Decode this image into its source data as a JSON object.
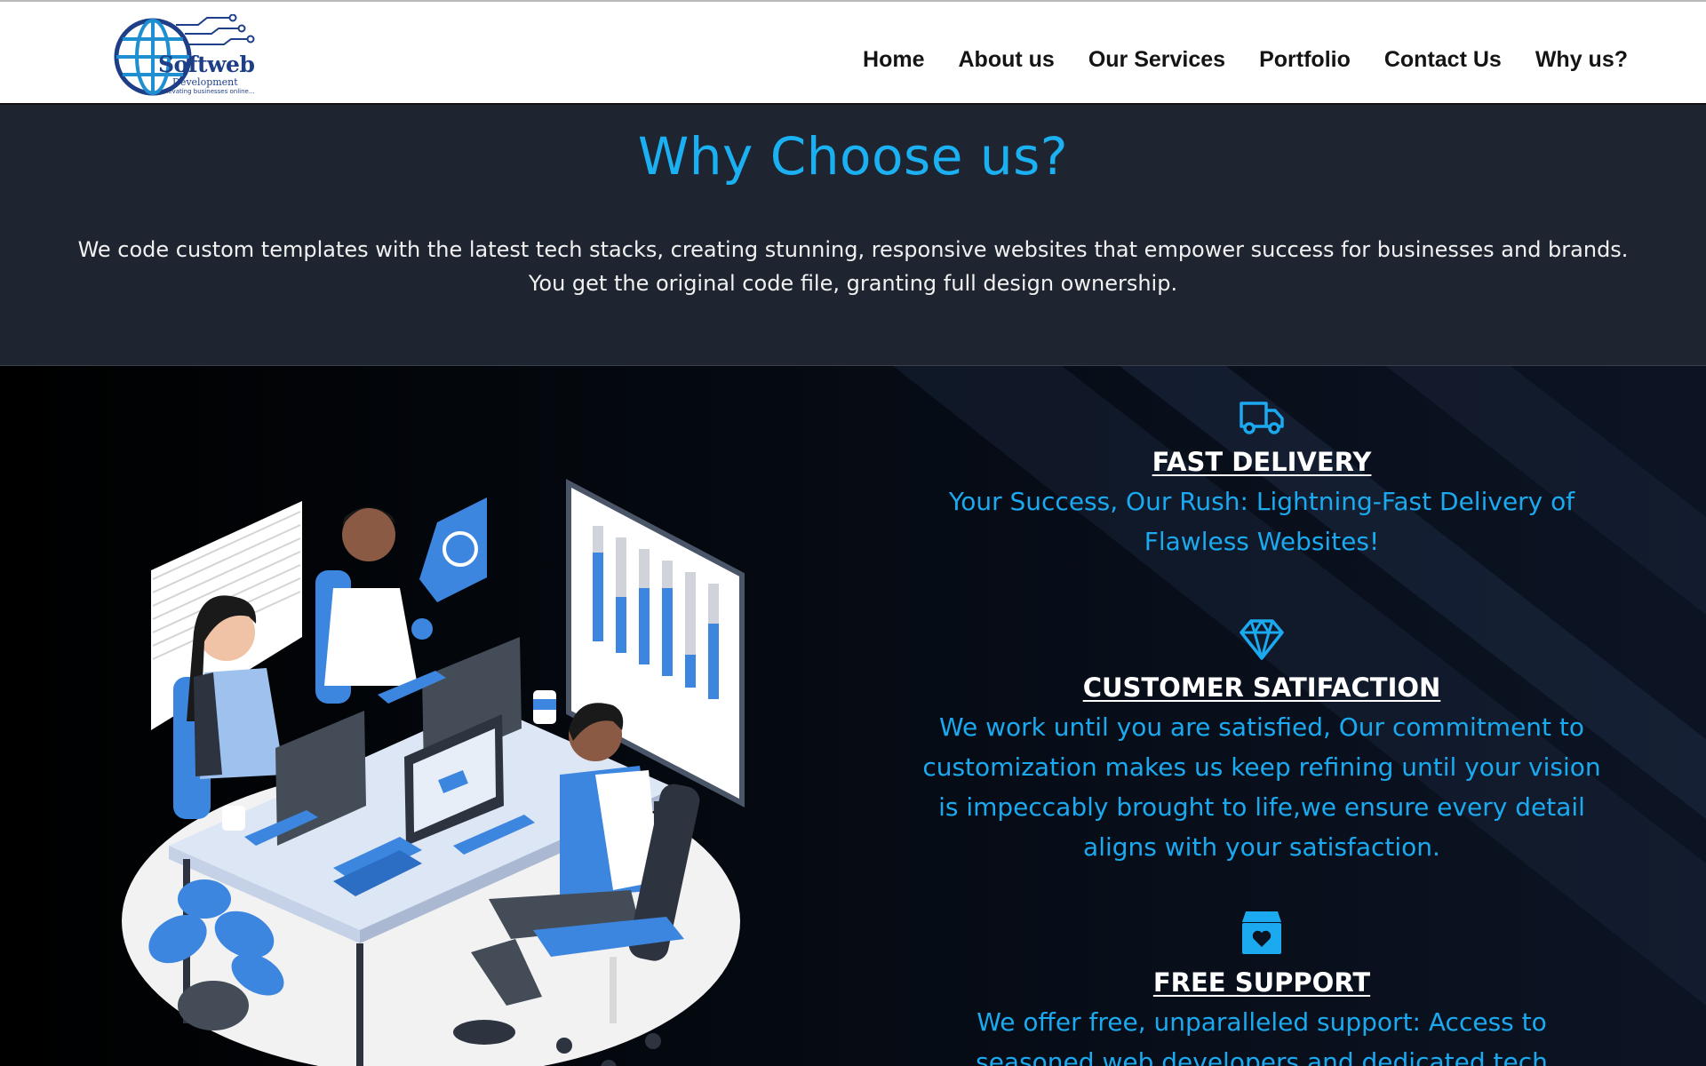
{
  "brand": {
    "name": "Softweb",
    "sub": "Development",
    "tagline": "elevating businesses online...",
    "colors": {
      "primary": "#1e3f88",
      "accent": "#1ba9ef"
    }
  },
  "nav": {
    "items": [
      {
        "label": "Home"
      },
      {
        "label": "About us"
      },
      {
        "label": "Our Services"
      },
      {
        "label": "Portfolio"
      },
      {
        "label": "Contact Us"
      },
      {
        "label": "Why us?"
      }
    ]
  },
  "intro": {
    "title": "Why Choose us?",
    "text": "We code custom templates with the latest tech stacks, creating stunning, responsive websites that empower success for businesses and brands. You get the original code file, granting full design ownership."
  },
  "features": [
    {
      "icon": "truck-icon",
      "title": "FAST DELIVERY",
      "text": "Your Success, Our Rush: Lightning-Fast Delivery of Flawless Websites!"
    },
    {
      "icon": "diamond-icon",
      "title": "CUSTOMER SATIFACTION",
      "text": "We work until you are satisfied, Our commitment to customization makes us keep refining until your vision is impeccably brought to life,we ensure every detail aligns with your satisfaction."
    },
    {
      "icon": "heart-box-icon",
      "title": "FREE SUPPORT",
      "text": "We offer free, unparalleled support: Access to seasoned web developers and dedicated tech"
    }
  ],
  "colors": {
    "heading": "#1bb0f2",
    "intro_bg": "#1f2530",
    "illustration_blue": "#3d86e0"
  }
}
